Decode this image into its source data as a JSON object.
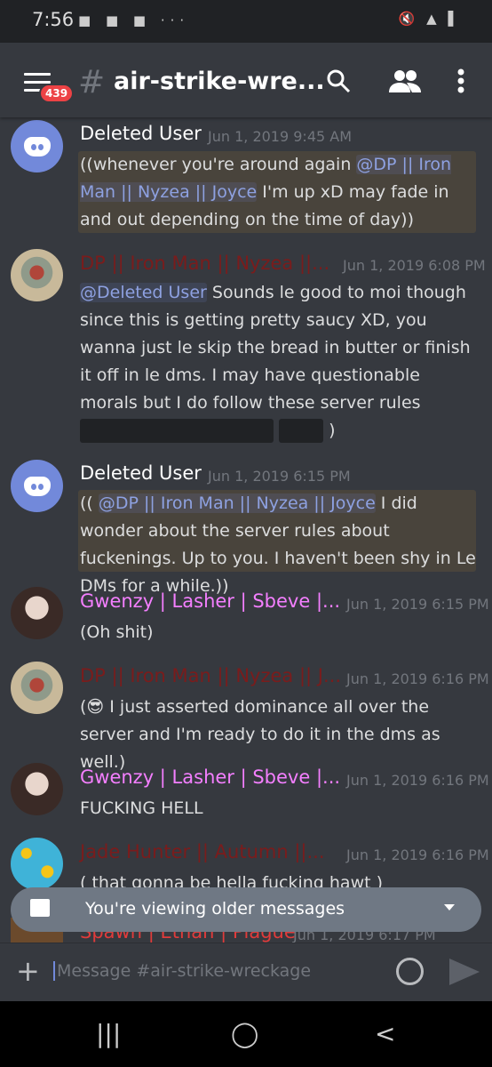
{
  "status_bar": {
    "time": "7:56",
    "notifications": "■ ■ ■ ···",
    "system": "🔇 ▲ ▌"
  },
  "header": {
    "unread_badge": "439",
    "channel_hash": "#",
    "channel_title": "air-strike-wre..."
  },
  "colors": {
    "mention_highlight": "#49443c",
    "mention_text": "#8ea1e1",
    "red_role": "#8b1a1a",
    "pink_role": "#f47fff"
  },
  "messages": [
    {
      "author": "Deleted User",
      "author_color": "#ffffff",
      "timestamp": "Jun 1, 2019 9:45 AM",
      "avatar": "discord-logo",
      "parts": [
        "((whenever you're around again ",
        "@DP || Iron Man || Nyzea || Joyce",
        " I'm up xD may fade in and out depending on the time of day))"
      ]
    },
    {
      "author": "DP || Iron Man || Nyzea ||...",
      "author_color": "#7a1c1c",
      "timestamp": "Jun 1, 2019 6:08 PM",
      "avatar": "painting",
      "parts": [
        "@Deleted User",
        " Sounds le good to moi though since this is getting pretty saucy XD, you wanna just le skip the bread in butter or finish it off in le dms. I may have questionable morals but I do follow these server rules ",
        ")"
      ]
    },
    {
      "author": "Deleted User",
      "author_color": "#ffffff",
      "timestamp": "Jun 1, 2019 6:15 PM",
      "avatar": "discord-logo",
      "parts": [
        "(( ",
        "@DP || Iron Man || Nyzea || Joyce",
        " I did wonder about the server rules about fuckenings. Up to you. I haven't been shy in Le DMs for a while.))"
      ]
    },
    {
      "author": "Gwenzy | Lasher | Sbeve |...",
      "author_color": "#f47fff",
      "timestamp": "Jun 1, 2019 6:15 PM",
      "avatar": "photo",
      "text": "(Oh shit)"
    },
    {
      "author": "DP || Iron Man || Nyzea || J...",
      "author_color": "#7a1c1c",
      "timestamp": "Jun 1, 2019 6:16 PM",
      "avatar": "painting",
      "emoji": "😎",
      "text": " I just asserted dominance all over the server and I'm ready to do it in the dms as well.)",
      "prefix": "("
    },
    {
      "author": "Gwenzy | Lasher | Sbeve |...",
      "author_color": "#f47fff",
      "timestamp": "Jun 1, 2019 6:16 PM",
      "avatar": "photo",
      "text": "FUCKING HELL"
    },
    {
      "author": "Jade Hunter || Autumn ||...",
      "author_color": "#7a1c1c",
      "timestamp": "Jun 1, 2019 6:16 PM",
      "avatar": "lemons",
      "text": "( that gonna be hella fucking hawt )"
    },
    {
      "author": "Spawn | Ethan | Plague",
      "author_color": "#e03b3b",
      "timestamp": "Jun 1, 2019 6:17 PM",
      "avatar": "photo"
    }
  ],
  "banner": {
    "text": "You're viewing older messages"
  },
  "composer": {
    "placeholder": "Message #air-strike-wreckage"
  },
  "nav_bar": {
    "recents": "|||",
    "home": "◯",
    "back": "<"
  }
}
